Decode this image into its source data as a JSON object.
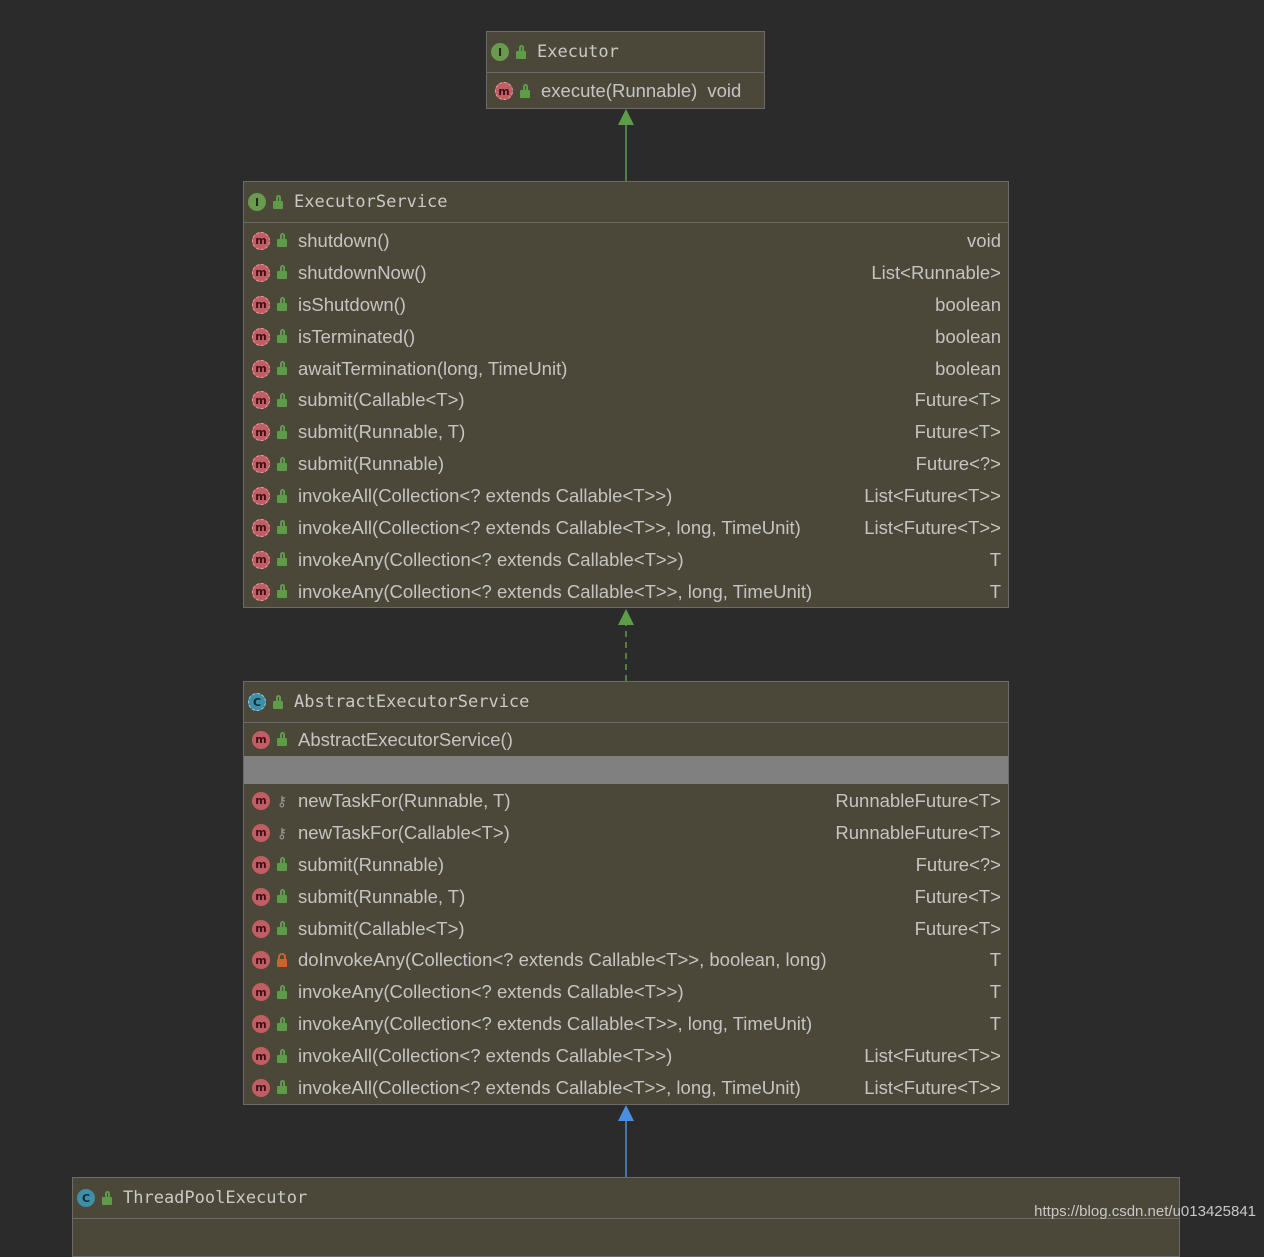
{
  "executor": {
    "title": "Executor",
    "icon": "interface-icon",
    "methods": [
      {
        "name": "execute(Runnable)",
        "ret": "void"
      }
    ]
  },
  "executor_service": {
    "title": "ExecutorService",
    "icon": "interface-icon",
    "methods": [
      {
        "name": "shutdown()",
        "ret": "void"
      },
      {
        "name": "shutdownNow()",
        "ret": "List<Runnable>"
      },
      {
        "name": "isShutdown()",
        "ret": "boolean"
      },
      {
        "name": "isTerminated()",
        "ret": "boolean"
      },
      {
        "name": "awaitTermination(long, TimeUnit)",
        "ret": "boolean"
      },
      {
        "name": "submit(Callable<T>)",
        "ret": "Future<T>"
      },
      {
        "name": "submit(Runnable, T)",
        "ret": "Future<T>"
      },
      {
        "name": "submit(Runnable)",
        "ret": "Future<?>"
      },
      {
        "name": "invokeAll(Collection<? extends Callable<T>>)",
        "ret": "List<Future<T>>"
      },
      {
        "name": "invokeAll(Collection<? extends Callable<T>>, long, TimeUnit)",
        "ret": "List<Future<T>>"
      },
      {
        "name": "invokeAny(Collection<? extends Callable<T>>)",
        "ret": "T"
      },
      {
        "name": "invokeAny(Collection<? extends Callable<T>>, long, TimeUnit)",
        "ret": "T"
      }
    ]
  },
  "abstract_executor_service": {
    "title": "AbstractExecutorService",
    "icon": "abstract-class-icon",
    "constructor": "AbstractExecutorService()",
    "methods": [
      {
        "name": "newTaskFor(Runnable, T)",
        "ret": "RunnableFuture<T>",
        "vis": "protected"
      },
      {
        "name": "newTaskFor(Callable<T>)",
        "ret": "RunnableFuture<T>",
        "vis": "protected"
      },
      {
        "name": "submit(Runnable)",
        "ret": "Future<?>",
        "vis": "public"
      },
      {
        "name": "submit(Runnable, T)",
        "ret": "Future<T>",
        "vis": "public"
      },
      {
        "name": "submit(Callable<T>)",
        "ret": "Future<T>",
        "vis": "public"
      },
      {
        "name": "doInvokeAny(Collection<? extends Callable<T>>, boolean, long)",
        "ret": "T",
        "vis": "private"
      },
      {
        "name": "invokeAny(Collection<? extends Callable<T>>)",
        "ret": "T",
        "vis": "public"
      },
      {
        "name": "invokeAny(Collection<? extends Callable<T>>, long, TimeUnit)",
        "ret": "T",
        "vis": "public"
      },
      {
        "name": "invokeAll(Collection<? extends Callable<T>>)",
        "ret": "List<Future<T>>",
        "vis": "public"
      },
      {
        "name": "invokeAll(Collection<? extends Callable<T>>, long, TimeUnit)",
        "ret": "List<Future<T>>",
        "vis": "public"
      }
    ]
  },
  "thread_pool_executor": {
    "title": "ThreadPoolExecutor",
    "icon": "class-icon"
  },
  "edge_colors": {
    "extends_interface": "#5e9c48",
    "implements": "#5e9c48",
    "extends_class": "#4a8fe0"
  },
  "watermark": "https://blog.csdn.net/u013425841"
}
